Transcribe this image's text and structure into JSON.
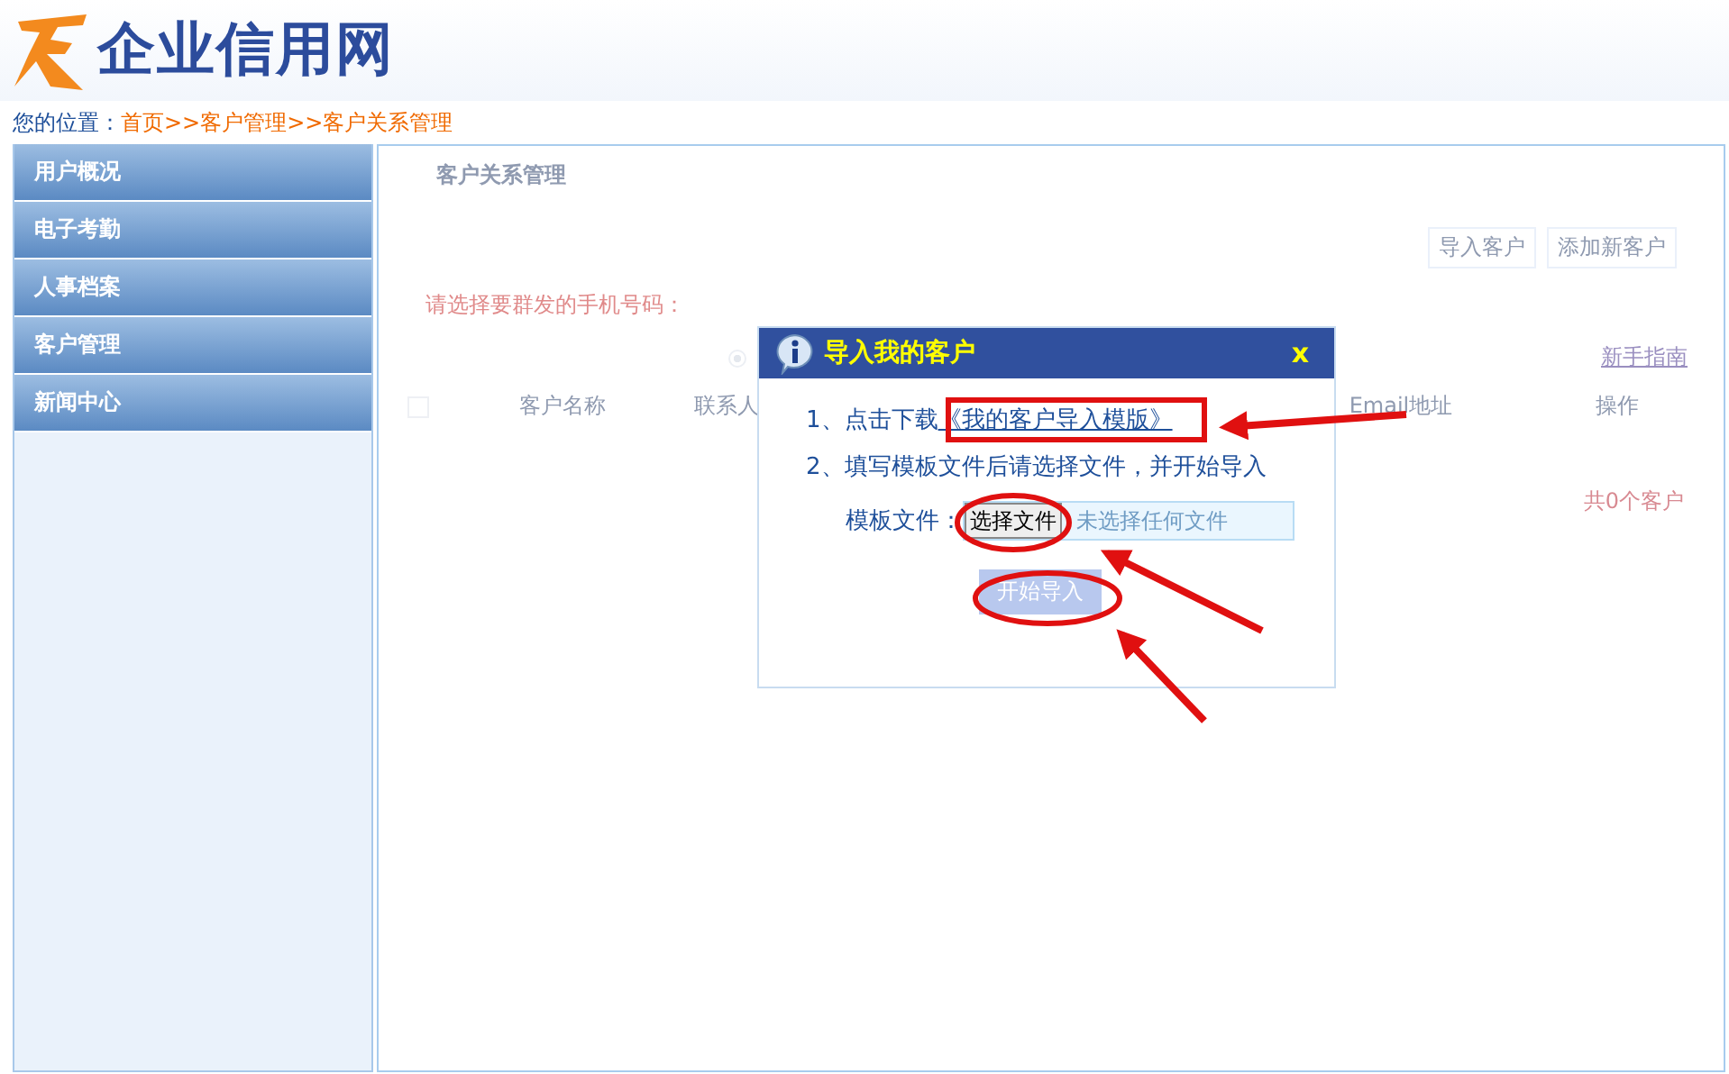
{
  "logo": {
    "text": "企业信用网"
  },
  "breadcrumb": {
    "label": "您的位置：",
    "links": [
      {
        "text": "首页"
      },
      {
        "prefix": ">>",
        "text": "客户管理"
      },
      {
        "prefix": ">>",
        "text": "客户关系管理"
      }
    ]
  },
  "sidebar": {
    "items": [
      {
        "label": "用户概况"
      },
      {
        "label": "电子考勤"
      },
      {
        "label": "人事档案"
      },
      {
        "label": "客户管理"
      },
      {
        "label": "新闻中心"
      }
    ]
  },
  "main": {
    "title": "客户关系管理",
    "buttons": [
      "导入客户",
      "添加新客户"
    ],
    "prompt": "请选择要群发的手机号码：",
    "radios": [
      {
        "selected": true
      }
    ],
    "guide_link": "新手指南",
    "table": {
      "columns": [
        "客户名称",
        "联系人",
        "Email地址",
        "操作"
      ],
      "select_all": {
        "checked": false
      }
    },
    "total": "共0个客户"
  },
  "dialog": {
    "title": "导入我的客户",
    "close": "x",
    "step1": "1、点击下载",
    "template_link": "《我的客户导入模版》",
    "step2": "2、填写模板文件后请选择文件，并开始导入",
    "file_label": "模板文件：",
    "file_button": "选择文件",
    "file_status": "未选择任何文件",
    "submit": "开始导入"
  }
}
